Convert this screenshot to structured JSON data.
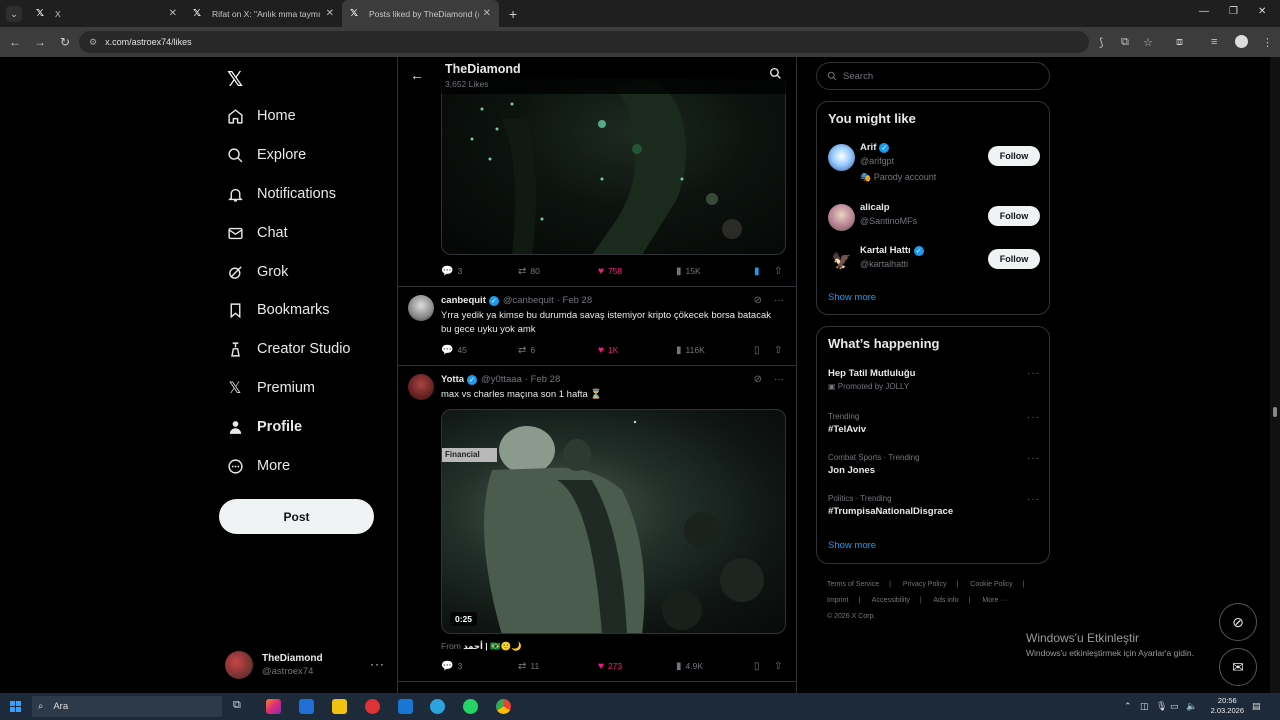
{
  "browser": {
    "tabs": [
      {
        "label": "X",
        "active": false
      },
      {
        "label": "Rifat on X: \"Anlık mma taymı ht",
        "active": false
      },
      {
        "label": "Posts liked by TheDiamond (@",
        "active": true
      }
    ],
    "url": "x.com/astroex74/likes"
  },
  "nav": {
    "items": [
      {
        "label": "Home",
        "icon": "home-icon"
      },
      {
        "label": "Explore",
        "icon": "search-icon"
      },
      {
        "label": "Notifications",
        "icon": "bell-icon"
      },
      {
        "label": "Chat",
        "icon": "mail-icon"
      },
      {
        "label": "Grok",
        "icon": "grok-icon"
      },
      {
        "label": "Bookmarks",
        "icon": "bookmark-icon"
      },
      {
        "label": "Creator Studio",
        "icon": "creator-icon"
      },
      {
        "label": "Premium",
        "icon": "x-icon"
      },
      {
        "label": "Profile",
        "icon": "person-icon"
      },
      {
        "label": "More",
        "icon": "more-circle-icon"
      }
    ],
    "post_label": "Post",
    "account": {
      "name": "TheDiamond",
      "handle": "@astroex74"
    }
  },
  "header": {
    "title": "TheDiamond",
    "subtitle": "3,652 Likes"
  },
  "tweets": [
    {
      "replies": "3",
      "reposts": "80",
      "likes": "758",
      "views": "15K"
    },
    {
      "name": "canbequit",
      "handle": "@canbequit",
      "date": "· Feb 28",
      "text": "Yrra yedik ya kimse bu durumda savaş istemiyor kripto çökecek borsa batacak bu gece uyku yok amk",
      "replies": "45",
      "reposts": "6",
      "likes": "1K",
      "views": "116K"
    },
    {
      "name": "Yotta",
      "handle": "@y0ttaaa",
      "date": "· Feb 28",
      "text": "max vs charles maçına son 1 hafta ⏳",
      "video_banner": "Financial",
      "duration": "0:25",
      "from_label": "From",
      "from_name": "أحمد |",
      "replies": "3",
      "reposts": "11",
      "likes": "273",
      "views": "4.9K"
    }
  ],
  "right": {
    "search_placeholder": "Search",
    "wtf_title": "You might like",
    "follow_label": "Follow",
    "suggestions": [
      {
        "name": "Arif",
        "handle": "@arifgpt",
        "extra": "Parody account"
      },
      {
        "name": "alicalp",
        "handle": "@SantinoMFs"
      },
      {
        "name": "Kartal Hattı",
        "handle": "@kartalhatti"
      }
    ],
    "show_more": "Show more",
    "trends_title": "What’s happening",
    "trends": [
      {
        "context": "Promoted by JOLLY",
        "title": "Hep Tatil Mutluluğu"
      },
      {
        "context": "Trending",
        "title": "#TelAviv"
      },
      {
        "context": "Combat Sports · Trending",
        "title": "Jon Jones"
      },
      {
        "context": "Politics · Trending",
        "title": "#TrumpisaNationalDisgrace"
      }
    ],
    "footer": [
      "Terms of Service",
      "|",
      "Privacy Policy",
      "|",
      "Cookie Policy",
      "|",
      "Imprint",
      "|",
      "Accessibility",
      "|",
      "Ads info",
      "|",
      "More ···",
      "© 2026 X Corp."
    ]
  },
  "windows": {
    "watermark_title": "Windows'u Etkinleştir",
    "watermark_sub": "Windows'u etkinleştirmek için Ayarlar'a gidin.",
    "search": "Ara",
    "time": "20:56",
    "date": "2.03.2026"
  },
  "colors": {
    "accent": "#1d9bf0",
    "like": "#f91880",
    "border": "#2f3336",
    "muted": "#71767b"
  }
}
